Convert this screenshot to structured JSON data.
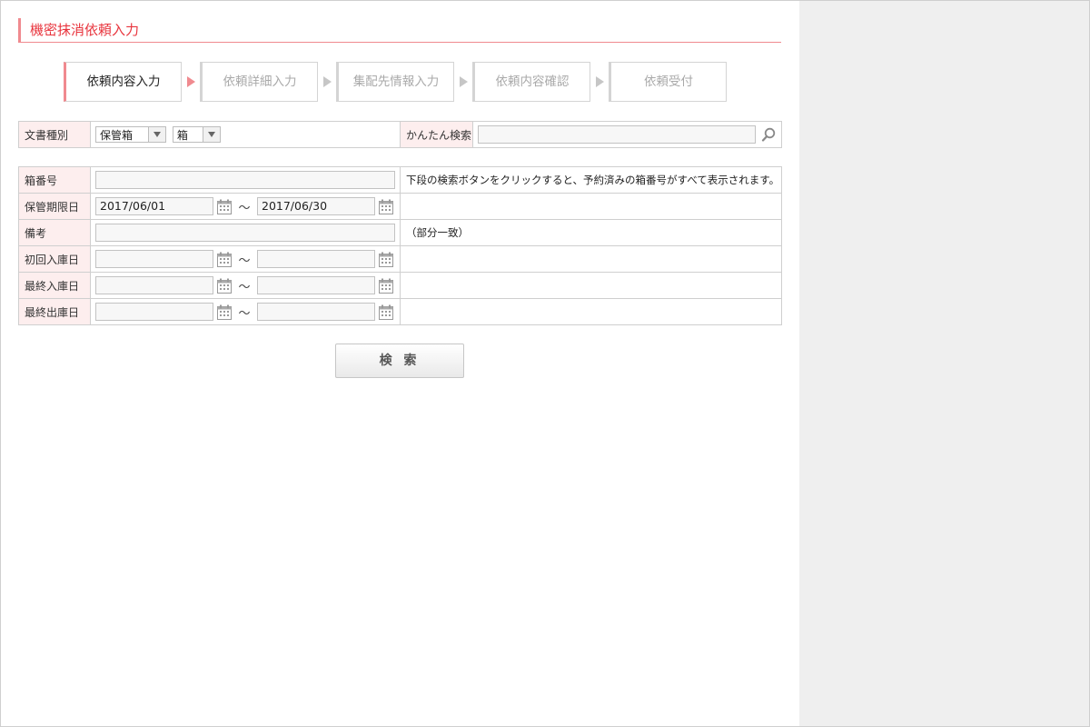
{
  "page": {
    "title": "機密抹消依頼入力"
  },
  "steps": [
    {
      "label": "依頼内容入力",
      "active": true
    },
    {
      "label": "依頼詳細入力",
      "active": false
    },
    {
      "label": "集配先情報入力",
      "active": false
    },
    {
      "label": "依頼内容確認",
      "active": false
    },
    {
      "label": "依頼受付",
      "active": false
    }
  ],
  "top_row": {
    "doc_type_label": "文書種別",
    "doc_type_select1": "保管箱",
    "doc_type_select2": "箱",
    "quick_search_label": "かんたん検索",
    "quick_search_value": ""
  },
  "form": {
    "box_number": {
      "label": "箱番号",
      "value": "",
      "note": "下段の検索ボタンをクリックすると、予約済みの箱番号がすべて表示されます。"
    },
    "retention_period": {
      "label": "保管期限日",
      "from": "2017/06/01",
      "to": "2017/06/30",
      "separator": "〜"
    },
    "remarks": {
      "label": "備考",
      "value": "",
      "note": "（部分一致）"
    },
    "first_storage_date": {
      "label": "初回入庫日",
      "from": "",
      "to": "",
      "separator": "〜"
    },
    "last_storage_date": {
      "label": "最終入庫日",
      "from": "",
      "to": "",
      "separator": "〜"
    },
    "last_retrieval_date": {
      "label": "最終出庫日",
      "from": "",
      "to": "",
      "separator": "〜"
    }
  },
  "search_button": {
    "label": "検 索"
  },
  "colors": {
    "accent": "#e8343d",
    "accent_light": "#f08a8f",
    "label_bg": "#fdeeee",
    "side_panel": "#efefef"
  }
}
